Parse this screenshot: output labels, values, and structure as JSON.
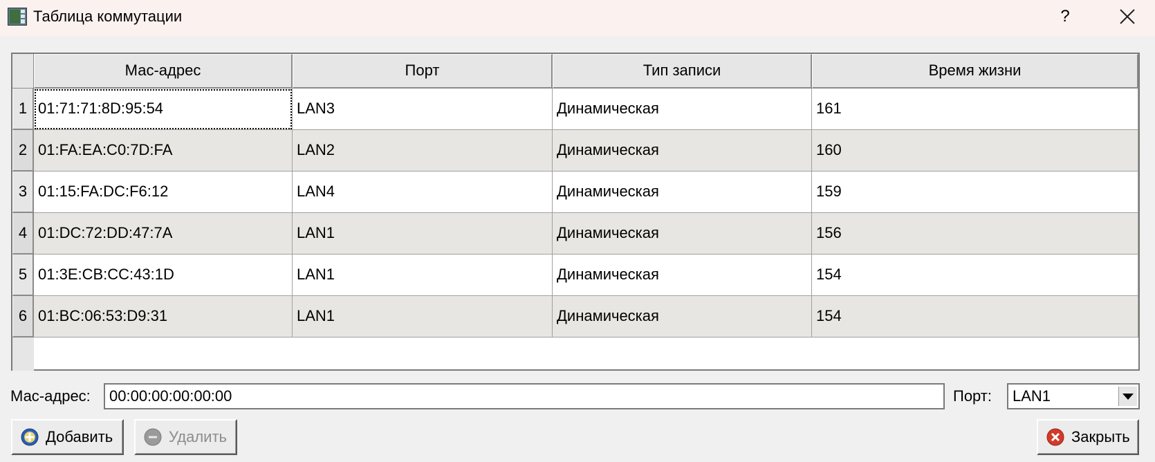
{
  "window": {
    "title": "Таблица коммутации",
    "help_label": "?"
  },
  "table": {
    "columns": [
      "Мас-адрес",
      "Порт",
      "Тип записи",
      "Время жизни"
    ],
    "rows": [
      {
        "num": "1",
        "mac": "01:71:71:8D:95:54",
        "port": "LAN3",
        "type": "Динамическая",
        "ttl": "161"
      },
      {
        "num": "2",
        "mac": "01:FA:EA:C0:7D:FA",
        "port": "LAN2",
        "type": "Динамическая",
        "ttl": "160"
      },
      {
        "num": "3",
        "mac": "01:15:FA:DC:F6:12",
        "port": "LAN4",
        "type": "Динамическая",
        "ttl": "159"
      },
      {
        "num": "4",
        "mac": "01:DC:72:DD:47:7A",
        "port": "LAN1",
        "type": "Динамическая",
        "ttl": "156"
      },
      {
        "num": "5",
        "mac": "01:3E:CB:CC:43:1D",
        "port": "LAN1",
        "type": "Динамическая",
        "ttl": "154"
      },
      {
        "num": "6",
        "mac": "01:BC:06:53:D9:31",
        "port": "LAN1",
        "type": "Динамическая",
        "ttl": "154"
      }
    ]
  },
  "form": {
    "mac_label": "Мас-адрес:",
    "mac_value": "00:00:00:00:00:00",
    "port_label": "Порт:",
    "port_value": "LAN1"
  },
  "buttons": {
    "add": "Добавить",
    "delete": "Удалить",
    "close": "Закрыть"
  },
  "colors": {
    "add_icon": "#2a5fb0",
    "delete_icon": "#9a9a9a",
    "close_icon": "#d23a2a"
  }
}
